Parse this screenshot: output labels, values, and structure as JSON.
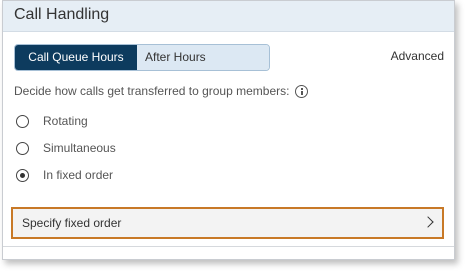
{
  "header": {
    "title": "Call Handling"
  },
  "tabs": [
    {
      "label": "Call Queue Hours",
      "active": true
    },
    {
      "label": "After Hours",
      "active": false
    }
  ],
  "advanced_link": "Advanced",
  "prompt": {
    "text": "Decide how calls get transferred to group members:",
    "icon": "info-icon"
  },
  "options": [
    {
      "label": "Rotating",
      "checked": false
    },
    {
      "label": "Simultaneous",
      "checked": false
    },
    {
      "label": "In fixed order",
      "checked": true
    }
  ],
  "fixed_order": {
    "label": "Specify fixed order",
    "icon": "chevron-right-icon"
  },
  "colors": {
    "tab_active_bg": "#0d3b5e",
    "tab_inactive_bg": "#dce8f3",
    "header_bg": "#e6eef5",
    "highlight_border": "#c87927"
  }
}
